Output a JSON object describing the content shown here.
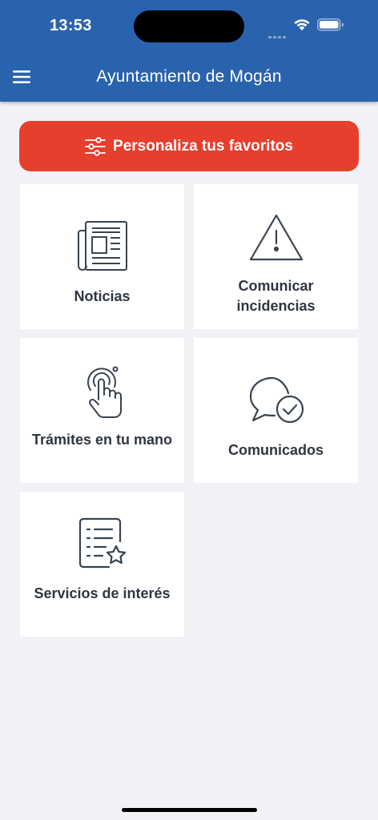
{
  "status_bar": {
    "time": "13:53"
  },
  "header": {
    "title": "Ayuntamiento de Mogán"
  },
  "favorites_button": {
    "label": "Personaliza tus favoritos"
  },
  "tiles": [
    {
      "label": "Noticias",
      "icon": "newspaper-icon"
    },
    {
      "label": "Comunicar incidencias",
      "icon": "warning-icon"
    },
    {
      "label": "Trámites en tu mano",
      "icon": "touch-icon"
    },
    {
      "label": "Comunicados",
      "icon": "chat-check-icon"
    },
    {
      "label": "Servicios de interés",
      "icon": "list-star-icon"
    }
  ],
  "colors": {
    "header": "#2a63ad",
    "accent_button": "#e63f2e",
    "background": "#f2f1f6",
    "tile": "#ffffff",
    "text": "#2e3640"
  }
}
